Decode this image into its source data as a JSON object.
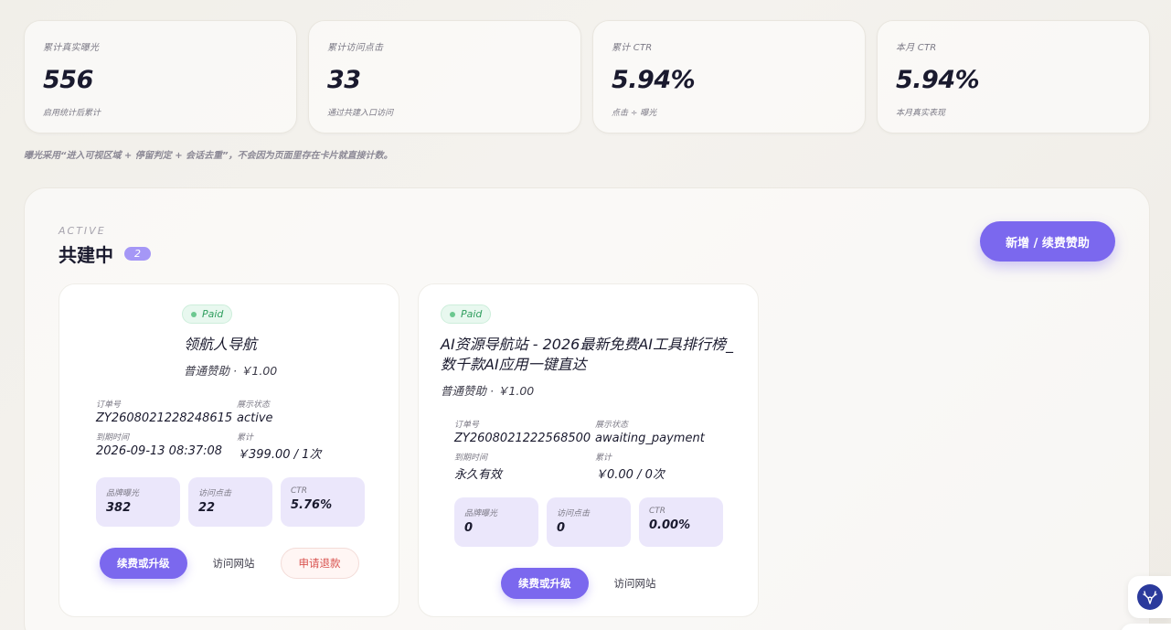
{
  "stats": [
    {
      "label": "累计真实曝光",
      "value": "556",
      "sub": "启用统计后累计"
    },
    {
      "label": "累计访问点击",
      "value": "33",
      "sub": "通过共建入口访问"
    },
    {
      "label": "累计 CTR",
      "value": "5.94%",
      "sub": "点击 ÷ 曝光"
    },
    {
      "label": "本月 CTR",
      "value": "5.94%",
      "sub": "本月真实表现"
    }
  ],
  "note": "曝光采用“进入可视区域 + 停留判定 + 会话去重”，不会因为页面里存在卡片就直接计数。",
  "section": {
    "eyebrow": "ACTIVE",
    "title": "共建中",
    "count": "2",
    "add_button": "新增 / 续费赞助"
  },
  "cards": [
    {
      "status": "Paid",
      "name": "领航人导航",
      "tier": "普通赞助 · ￥1.00",
      "order_label": "订单号",
      "order_value": "ZY2608021228248615",
      "display_label": "展示状态",
      "display_value": "active",
      "expire_label": "到期时间",
      "expire_value": "2026-09-13 08:37:08",
      "total_label": "累计",
      "total_value": "￥399.00 / 1次",
      "metrics": [
        {
          "label": "品牌曝光",
          "value": "382"
        },
        {
          "label": "访问点击",
          "value": "22"
        },
        {
          "label": "CTR",
          "value": "5.76%"
        }
      ],
      "btn_renew": "续费或升级",
      "btn_visit": "访问网站",
      "btn_refund": "申请退款"
    },
    {
      "status": "Paid",
      "name": "AI资源导航站 - 2026最新免费AI工具排行榜_数千款AI应用一键直达",
      "tier": "普通赞助 · ￥1.00",
      "order_label": "订单号",
      "order_value": "ZY2608021222568500",
      "display_label": "展示状态",
      "display_value": "awaiting_payment",
      "expire_label": "到期时间",
      "expire_value": "永久有效",
      "total_label": "累计",
      "total_value": "￥0.00 / 0次",
      "metrics": [
        {
          "label": "品牌曝光",
          "value": "0"
        },
        {
          "label": "访问点击",
          "value": "0"
        },
        {
          "label": "CTR",
          "value": "0.00%"
        }
      ],
      "btn_renew": "续费或升级",
      "btn_visit": "访问网站"
    }
  ],
  "colors": {
    "accent": "#7b68ee",
    "paid_green": "#2f9e5e",
    "danger": "#d9534f"
  }
}
